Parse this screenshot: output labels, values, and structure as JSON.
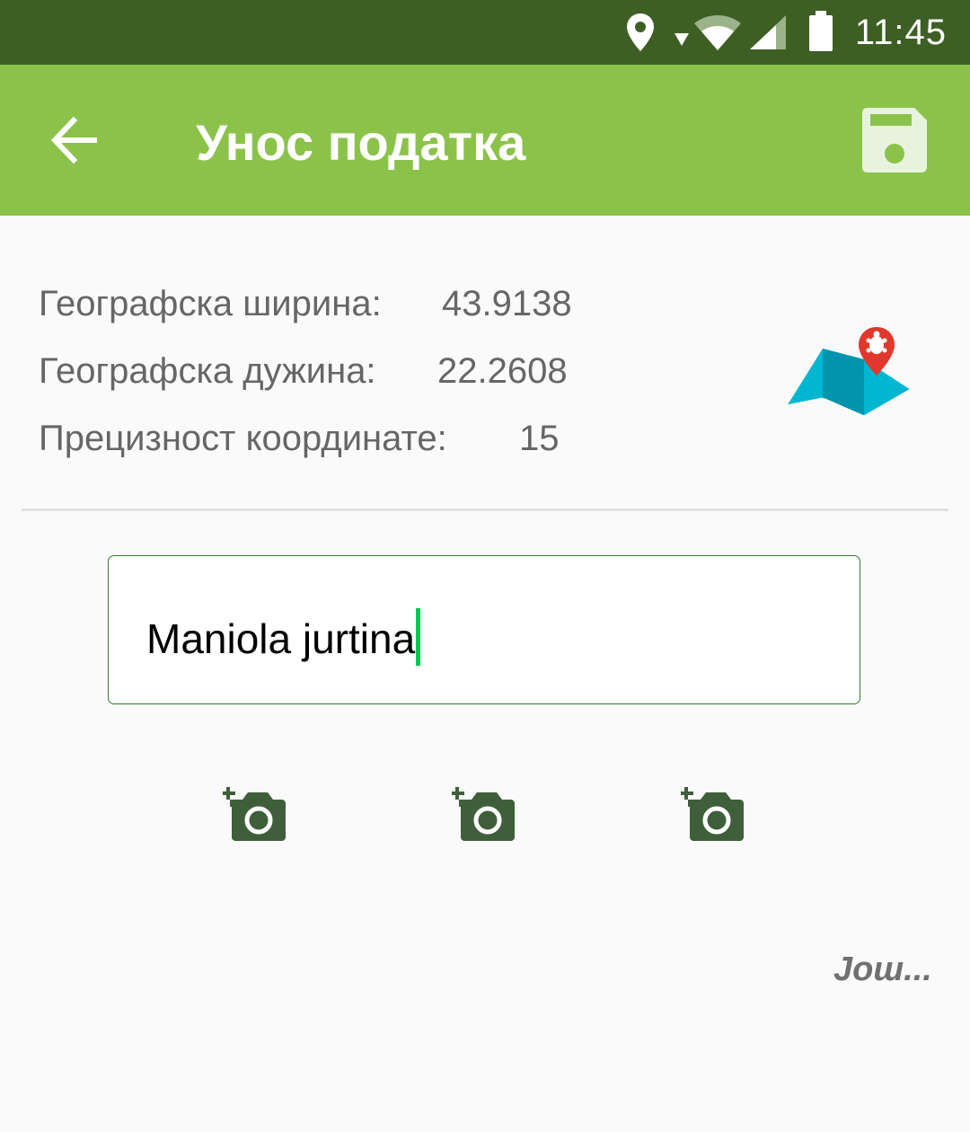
{
  "status_bar": {
    "time": "11:45",
    "icons": [
      "location-icon",
      "data-arrow-icon",
      "wifi-icon",
      "signal-icon",
      "battery-icon"
    ]
  },
  "app_bar": {
    "title": "Унос податка",
    "back_icon": "arrow-back-icon",
    "save_icon": "save-icon",
    "color": "#8bc34a",
    "status_color": "#3e5f24"
  },
  "coordinates": {
    "latitude_label": "Географска ширина:",
    "latitude_value": "43.9138",
    "longitude_label": "Географска дужина:",
    "longitude_value": "22.2608",
    "precision_label": "Прецизност координате:",
    "precision_value": "15",
    "map_icon": "map-pin-icon"
  },
  "entry": {
    "name_value": "Maniola jurtina",
    "accent_color": "#00c853"
  },
  "photos": {
    "icons": [
      "add-photo-icon",
      "add-photo-icon",
      "add-photo-icon"
    ],
    "color": "#3e5f3a"
  },
  "more_label": "Још..."
}
